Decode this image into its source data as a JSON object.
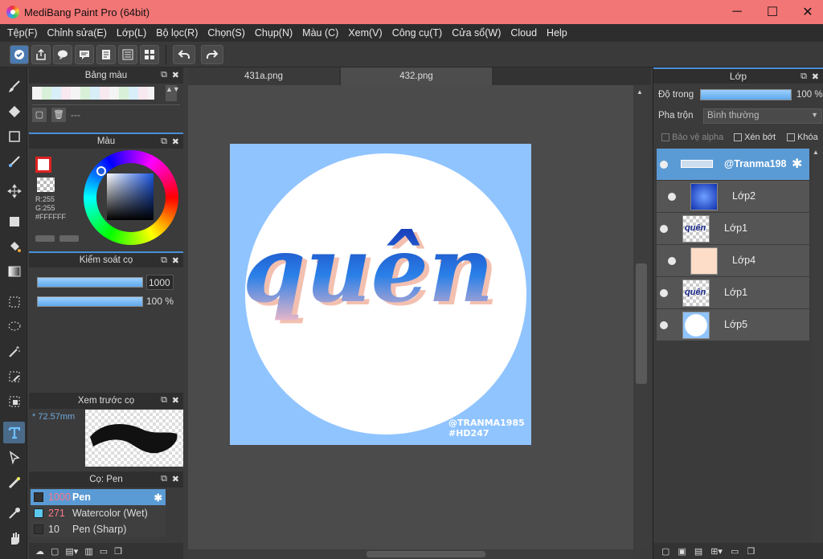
{
  "window": {
    "title": "MediBang Paint Pro (64bit)",
    "minimize": "─",
    "maximize": "☐",
    "close": "✕"
  },
  "menu": [
    "Tệp(F)",
    "Chỉnh sửa(E)",
    "Lớp(L)",
    "Bộ lọc(R)",
    "Chọn(S)",
    "Chụp(N)",
    "Màu (C)",
    "Xem(V)",
    "Công cụ(T)",
    "Cửa sổ(W)",
    "Cloud",
    "Help"
  ],
  "tabs": [
    "431a.png",
    "432.png"
  ],
  "palette_panel": {
    "title": "Bảng màu",
    "text": "---"
  },
  "color_panel": {
    "title": "Màu",
    "r": "R:255",
    "g": "G:255",
    "hex": "#FFFFFF"
  },
  "brush_control": {
    "title": "Kiểm soát cọ",
    "size": "1000",
    "opacity": "100 %"
  },
  "brush_preview": {
    "title": "Xem trước cọ",
    "size": "72.57mm"
  },
  "brush_list": {
    "title": "Cọ: Pen",
    "items": [
      {
        "size": "1000",
        "name": "Pen",
        "color": "#333333"
      },
      {
        "size": "271",
        "name": "Watercolor (Wet)",
        "color": "#5bc8f0"
      },
      {
        "size": "10",
        "name": "Pen (Sharp)",
        "color": "#333333"
      }
    ]
  },
  "layers": {
    "title": "Lớp",
    "opacity_label": "Độ trong",
    "opacity_value": "100 %",
    "blend_label": "Pha trộn",
    "blend_value": "Bình thường",
    "protect_alpha": "Bảo vệ alpha",
    "clip": "Xén bớt",
    "lock": "Khóa",
    "items": [
      {
        "name": "@Tranma198"
      },
      {
        "name": "Lớp2"
      },
      {
        "name": "Lớp1"
      },
      {
        "name": "Lớp4"
      },
      {
        "name": "Lớp1"
      },
      {
        "name": "Lớp5"
      }
    ]
  },
  "artwork": {
    "word": "quên",
    "credit1": "@TRANMA1985",
    "credit2": "#HD247"
  },
  "colors": {
    "accent": "#4a90d9",
    "titlebar": "#f37676",
    "canvas_bg": "#90c4ff",
    "selected": "#5b9bd5"
  }
}
